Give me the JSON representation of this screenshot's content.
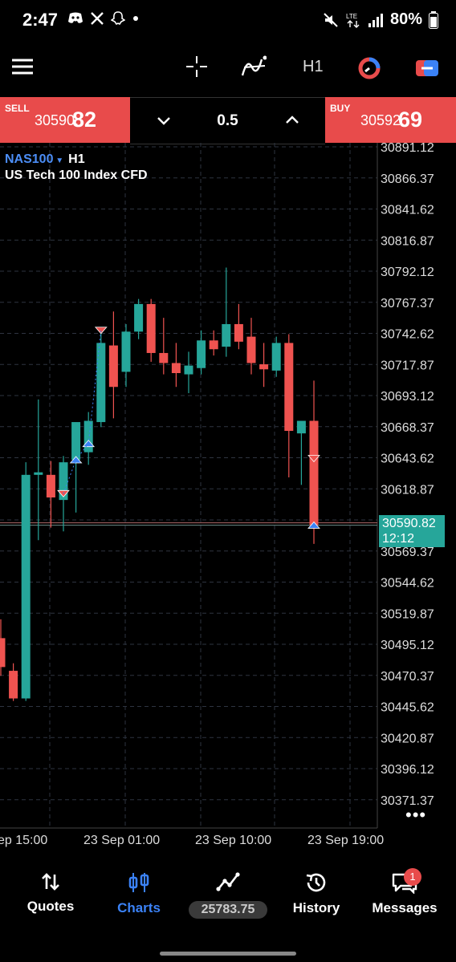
{
  "status_bar": {
    "time": "2:47",
    "battery_percent": "80%",
    "icons_left": [
      "discord-icon",
      "x-icon",
      "snapchat-icon",
      "dot-icon"
    ],
    "icons_right": [
      "mute-icon",
      "lte-icon",
      "signal-icon",
      "battery-icon"
    ]
  },
  "toolbar": {
    "icons": [
      "menu-icon",
      "crosshair-icon",
      "indicators-icon",
      "timeframe",
      "trade-icon",
      "switch-icon"
    ],
    "timeframe": "H1"
  },
  "trade_bar": {
    "sell_label": "SELL",
    "sell_price_main": "30590.",
    "sell_price_big": "82",
    "volume": "0.5",
    "buy_label": "BUY",
    "buy_price_main": "30592.",
    "buy_price_big": "69"
  },
  "symbol": {
    "name": "NAS100",
    "timeframe": "H1",
    "description": "US Tech 100 Index CFD"
  },
  "chart_data": {
    "type": "candlestick",
    "y_axis_ticks": [
      "30891.12",
      "30866.37",
      "30841.62",
      "30816.87",
      "30792.12",
      "30767.37",
      "30742.62",
      "30717.87",
      "30693.12",
      "30668.37",
      "30643.62",
      "30618.87",
      "30569.37",
      "30544.62",
      "30519.87",
      "30495.12",
      "30470.37",
      "30445.62",
      "30420.87",
      "30396.12",
      "30371.37"
    ],
    "x_axis_ticks": [
      "ep 15:00",
      "23 Sep 01:00",
      "23 Sep 10:00",
      "23 Sep 19:00"
    ],
    "current_price": "30590.82",
    "countdown": "12:12",
    "colors": {
      "up": "#26a69a",
      "down": "#ef5350",
      "background": "#000000",
      "buy_arrow": "#3b82f6",
      "sell_arrow": "#ef5350"
    },
    "candles": [
      {
        "o": 30500,
        "h": 30515,
        "l": 30470,
        "c": 30477
      },
      {
        "o": 30474,
        "h": 30480,
        "l": 30450,
        "c": 30452
      },
      {
        "o": 30452,
        "h": 30640,
        "l": 30450,
        "c": 30630
      },
      {
        "o": 30630,
        "h": 30690,
        "l": 30578,
        "c": 30632
      },
      {
        "o": 30630,
        "h": 30641,
        "l": 30588,
        "c": 30612
      },
      {
        "o": 30610,
        "h": 30645,
        "l": 30585,
        "c": 30640
      },
      {
        "o": 30642,
        "h": 30670,
        "l": 30600,
        "c": 30672
      },
      {
        "o": 30648,
        "h": 30680,
        "l": 30638,
        "c": 30673
      },
      {
        "o": 30672,
        "h": 30745,
        "l": 30668,
        "c": 30735
      },
      {
        "o": 30733,
        "h": 30760,
        "l": 30675,
        "c": 30700
      },
      {
        "o": 30712,
        "h": 30750,
        "l": 30700,
        "c": 30744
      },
      {
        "o": 30744,
        "h": 30770,
        "l": 30738,
        "c": 30766
      },
      {
        "o": 30766,
        "h": 30770,
        "l": 30720,
        "c": 30727
      },
      {
        "o": 30727,
        "h": 30755,
        "l": 30710,
        "c": 30719
      },
      {
        "o": 30719,
        "h": 30735,
        "l": 30700,
        "c": 30711
      },
      {
        "o": 30710,
        "h": 30728,
        "l": 30695,
        "c": 30717
      },
      {
        "o": 30715,
        "h": 30745,
        "l": 30710,
        "c": 30737
      },
      {
        "o": 30737,
        "h": 30745,
        "l": 30725,
        "c": 30730
      },
      {
        "o": 30732,
        "h": 30795,
        "l": 30724,
        "c": 30750
      },
      {
        "o": 30750,
        "h": 30766,
        "l": 30730,
        "c": 30736
      },
      {
        "o": 30740,
        "h": 30755,
        "l": 30710,
        "c": 30719
      },
      {
        "o": 30718,
        "h": 30735,
        "l": 30700,
        "c": 30714
      },
      {
        "o": 30713,
        "h": 30740,
        "l": 30708,
        "c": 30735
      },
      {
        "o": 30735,
        "h": 30742,
        "l": 30628,
        "c": 30665
      },
      {
        "o": 30663,
        "h": 30672,
        "l": 30622,
        "c": 30673
      },
      {
        "o": 30673,
        "h": 30705,
        "l": 30575,
        "c": 30590
      }
    ]
  },
  "bottom_nav": {
    "quotes": "Quotes",
    "charts": "Charts",
    "balance": "25783.75",
    "history": "History",
    "messages": "Messages",
    "messages_badge": "1"
  }
}
